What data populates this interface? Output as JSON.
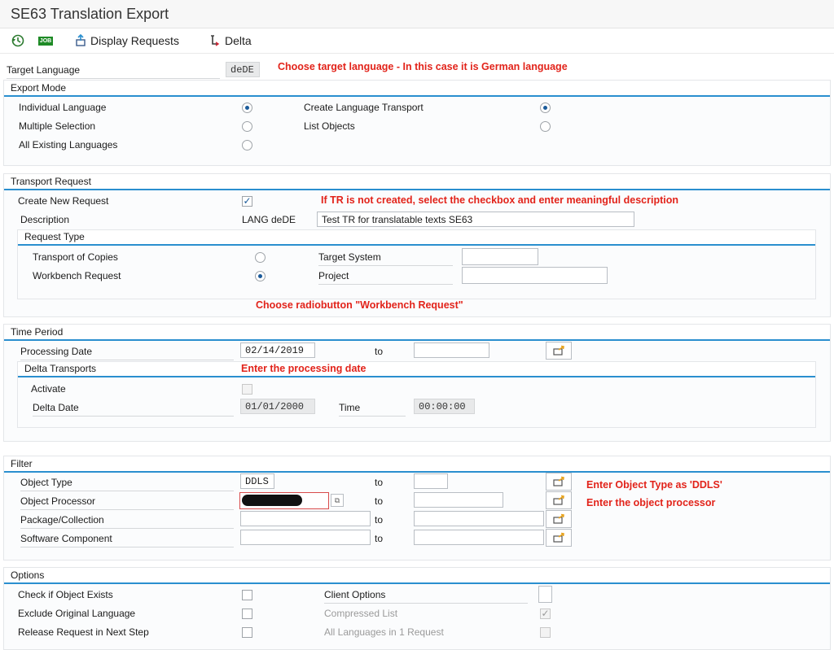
{
  "window": {
    "title": "SE63 Translation Export"
  },
  "toolbar": {
    "execute_icon": "execute-clock-icon",
    "job_label": "JOB",
    "display_requests": "Display Requests",
    "delta": "Delta"
  },
  "target_language": {
    "label": "Target Language",
    "value": "deDE",
    "note": "Choose target language - In this case it is German language"
  },
  "export_mode": {
    "title": "Export Mode",
    "individual_language": "Individual Language",
    "multiple_selection": "Multiple Selection",
    "all_existing_languages": "All Existing Languages",
    "create_language_transport": "Create Language Transport",
    "list_objects": "List Objects"
  },
  "transport_request": {
    "title": "Transport Request",
    "create_new_request": "Create New Request",
    "note": "If TR is not created, select the checkbox and enter meaningful description",
    "description_label": "Description",
    "description_prefix": "LANG deDE",
    "description_value": "Test TR for translatable texts SE63",
    "request_type": {
      "title": "Request Type",
      "transport_of_copies": "Transport of Copies",
      "workbench_request": "Workbench Request",
      "target_system": "Target System",
      "project": "Project"
    },
    "note2": "Choose radiobutton \"Workbench Request\""
  },
  "time_period": {
    "title": "Time Period",
    "processing_date_label": "Processing Date",
    "processing_date": "02/14/2019",
    "to": "to",
    "delta_transports": {
      "title": "Delta Transports",
      "note": "Enter the processing date",
      "activate": "Activate",
      "delta_date_label": "Delta Date",
      "delta_date": "01/01/2000",
      "time_label": "Time",
      "time": "00:00:00"
    }
  },
  "filter": {
    "title": "Filter",
    "object_type_label": "Object Type",
    "object_type": "DDLS",
    "object_processor_label": "Object Processor",
    "package_label": "Package/Collection",
    "software_component_label": "Software Component",
    "to": "to",
    "note_object_type": "Enter Object Type as 'DDLS'",
    "note_processor": "Enter the object processor"
  },
  "options": {
    "title": "Options",
    "check_object_exists": "Check if Object Exists",
    "exclude_original_language": "Exclude Original Language",
    "release_request": "Release Request in Next Step",
    "client_options": "Client Options",
    "compressed_list": "Compressed List",
    "all_languages": "All Languages in 1 Request"
  },
  "colors": {
    "accent": "#2a8fcf",
    "annotation": "#e2231a"
  }
}
